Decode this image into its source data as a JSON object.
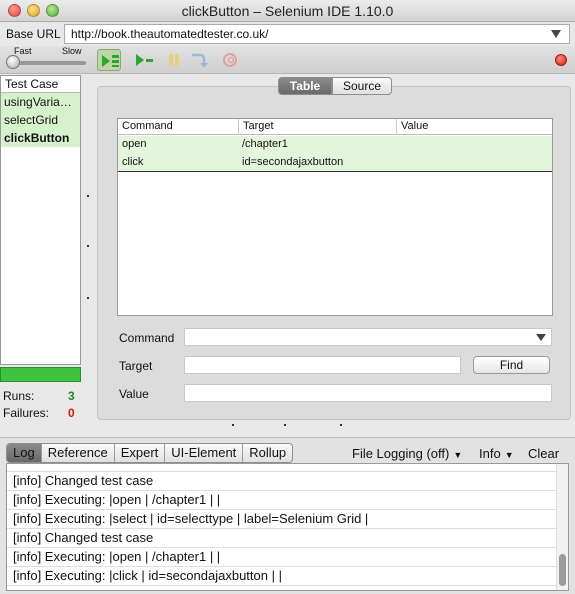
{
  "window": {
    "title": "clickButton – Selenium IDE 1.10.0"
  },
  "base_url": {
    "label": "Base URL",
    "value": "http://book.theautomatedtester.co.uk/"
  },
  "toolbar": {
    "fast_label": "Fast",
    "slow_label": "Slow",
    "speed": 0.0
  },
  "test_cases": {
    "header": "Test Case",
    "items": [
      {
        "label": "usingVaria…",
        "state": "passed"
      },
      {
        "label": "selectGrid",
        "state": "passed"
      },
      {
        "label": "clickButton",
        "state": "current"
      }
    ],
    "progress_fraction": 1.0,
    "runs_label": "Runs:",
    "runs_value": "3",
    "failures_label": "Failures:",
    "failures_value": "0"
  },
  "editor": {
    "tabs": [
      "Table",
      "Source"
    ],
    "active_tab": "Table",
    "columns": [
      "Command",
      "Target",
      "Value"
    ],
    "rows": [
      {
        "command": "open",
        "target": "/chapter1",
        "value": ""
      },
      {
        "command": "click",
        "target": "id=secondajaxbutton",
        "value": ""
      }
    ],
    "command_label": "Command",
    "target_label": "Target",
    "value_label": "Value",
    "find_label": "Find"
  },
  "log_panel": {
    "tabs": [
      "Log",
      "Reference",
      "Expert",
      "UI-Element",
      "Rollup"
    ],
    "active_tab": "Log",
    "file_logging": "File Logging (off)",
    "level": "Info",
    "clear": "Clear",
    "lines": [
      "[info] Changed test case",
      "[info] Executing: |open | /chapter1 | |",
      "[info] Executing: |select | id=selecttype | label=Selenium Grid |",
      "[info] Changed test case",
      "[info] Executing: |open | /chapter1 | |",
      "[info] Executing: |click | id=secondajaxbutton | |"
    ]
  },
  "colors": {
    "pass_bg": "#d6f2cc",
    "progress_green": "#3fc23f",
    "runs_green": "#1f8b1f",
    "failures_red": "#d21a12"
  }
}
